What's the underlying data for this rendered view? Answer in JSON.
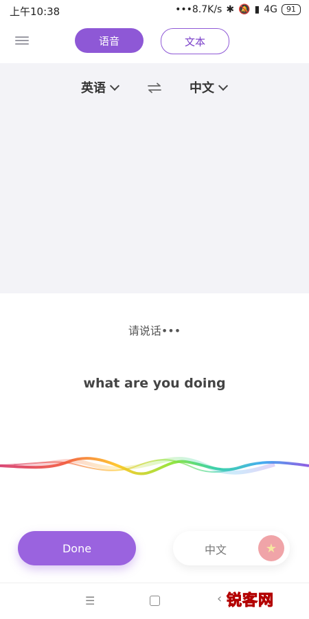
{
  "status": {
    "time": "上午10:38",
    "net_speed": "•••8.7K/s",
    "network": "4G",
    "battery": "91"
  },
  "header": {
    "tab_voice": "语音",
    "tab_text": "文本"
  },
  "languages": {
    "source": "英语",
    "target": "中文"
  },
  "prompt": "请说话•••",
  "transcript": "what are you doing",
  "actions": {
    "done_label": "Done",
    "language_label": "中文"
  },
  "colors": {
    "accent": "#8e58d6",
    "panel_bg": "#f3f3f7"
  },
  "watermark": "锐客网"
}
